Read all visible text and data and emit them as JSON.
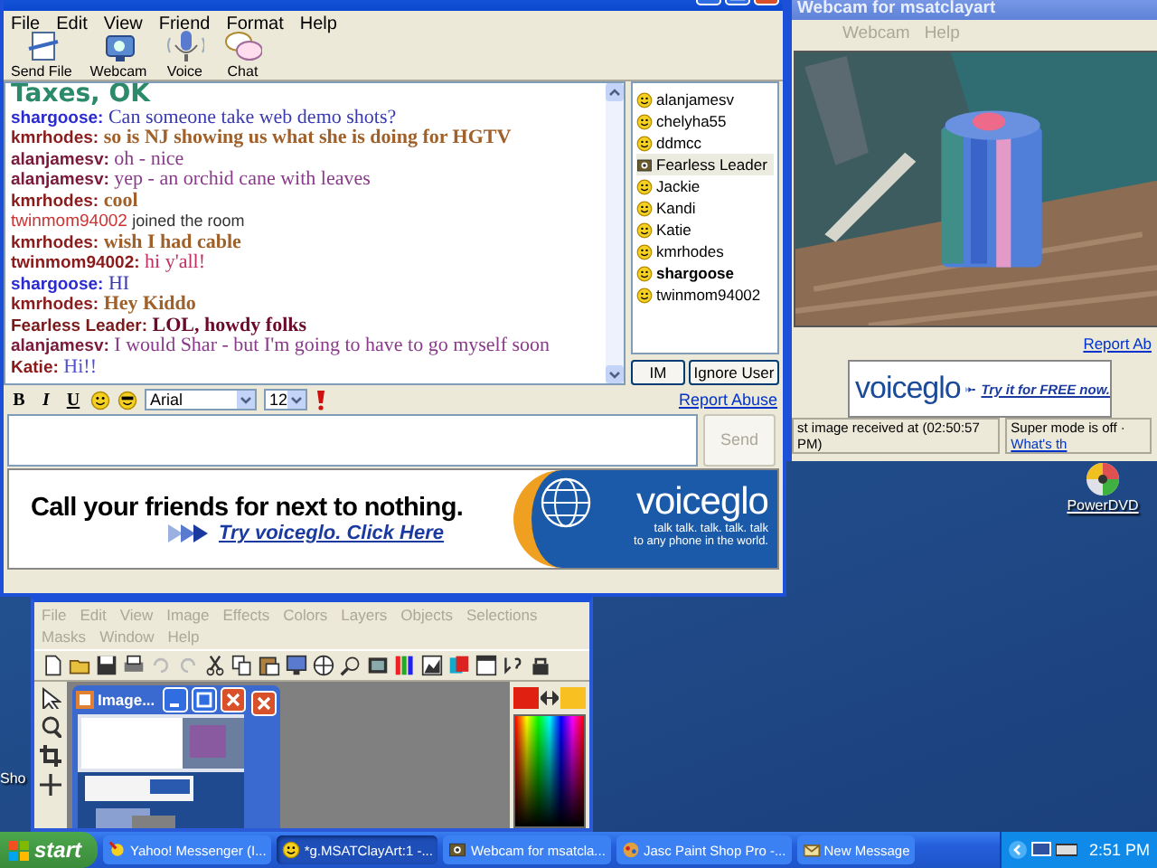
{
  "chat_window": {
    "menu": [
      "File",
      "Edit",
      "View",
      "Friend",
      "Format",
      "Help"
    ],
    "toolbar": [
      {
        "label": "Send File",
        "kind": "send_file"
      },
      {
        "label": "Webcam",
        "kind": "webcam"
      },
      {
        "label": "Voice",
        "kind": "voice"
      },
      {
        "label": "Chat",
        "kind": "chat"
      }
    ],
    "messages": [
      {
        "kind": "banner",
        "text": "Taxes, OK",
        "color": "#2a8a6a"
      },
      {
        "kind": "message",
        "user": {
          "name": "shargoose:",
          "color": "#2a2ad0"
        },
        "text": "Can someone take web demo shots?",
        "color": "#3a3ab0",
        "bold": false
      },
      {
        "kind": "message",
        "user": {
          "name": "kmrhodes:",
          "color": "#8b1a1a"
        },
        "text": "so is NJ showing us what she is doing for HGTV",
        "color": "#a0602a",
        "bold": true
      },
      {
        "kind": "message",
        "user": {
          "name": "alanjamesv:",
          "color": "#7a1a3a"
        },
        "text": "oh - nice",
        "color": "#8a3a8a",
        "bold": false
      },
      {
        "kind": "message",
        "user": {
          "name": "alanjamesv:",
          "color": "#7a1a3a"
        },
        "text": "yep - an orchid cane with leaves",
        "color": "#8a3a8a",
        "bold": false
      },
      {
        "kind": "message",
        "user": {
          "name": "kmrhodes:",
          "color": "#8b1a1a"
        },
        "text": "cool",
        "color": "#a0602a",
        "bold": true
      },
      {
        "kind": "join",
        "user": {
          "name": "twinmom94002",
          "color": "#cc3333"
        },
        "text": "joined the room",
        "color": "#333333",
        "bold": false
      },
      {
        "kind": "message",
        "user": {
          "name": "kmrhodes:",
          "color": "#8b1a1a"
        },
        "text": "wish I had cable",
        "color": "#a0602a",
        "bold": true
      },
      {
        "kind": "message",
        "user": {
          "name": "twinmom94002:",
          "color": "#8b1a1a"
        },
        "text": "hi y'all!",
        "color": "#c03060",
        "bold": false
      },
      {
        "kind": "message",
        "user": {
          "name": "shargoose:",
          "color": "#2a2ad0"
        },
        "text": "HI",
        "color": "#3a3ab0",
        "bold": false
      },
      {
        "kind": "message",
        "user": {
          "name": "kmrhodes:",
          "color": "#8b1a1a"
        },
        "text": "Hey Kiddo",
        "color": "#a0602a",
        "bold": true
      },
      {
        "kind": "message",
        "user": {
          "name": "Fearless Leader:",
          "color": "#7a1a1a"
        },
        "text": "LOL, howdy folks",
        "color": "#6a0a2a",
        "bold": true
      },
      {
        "kind": "message",
        "user": {
          "name": "alanjamesv:",
          "color": "#7a1a3a"
        },
        "text": "I would Shar - but I'm going to have to go myself soon",
        "color": "#8a3a8a",
        "bold": false
      },
      {
        "kind": "message",
        "user": {
          "name": "Katie:",
          "color": "#8b1a1a"
        },
        "text": "Hi!!",
        "color": "#5050d0",
        "bold": false
      }
    ],
    "users": [
      {
        "name": "alanjamesv",
        "kind": "smiley",
        "selected": false,
        "bold": false
      },
      {
        "name": "chelyha55",
        "kind": "smiley",
        "selected": false,
        "bold": false
      },
      {
        "name": "ddmcc",
        "kind": "smiley",
        "selected": false,
        "bold": false
      },
      {
        "name": "Fearless Leader",
        "kind": "webcam",
        "selected": true,
        "bold": false
      },
      {
        "name": "Jackie",
        "kind": "smiley",
        "selected": false,
        "bold": false
      },
      {
        "name": "Kandi",
        "kind": "smiley",
        "selected": false,
        "bold": false
      },
      {
        "name": "Katie",
        "kind": "smiley",
        "selected": false,
        "bold": false
      },
      {
        "name": "kmrhodes",
        "kind": "smiley",
        "selected": false,
        "bold": false
      },
      {
        "name": "shargoose",
        "kind": "smiley",
        "selected": false,
        "bold": true
      },
      {
        "name": "twinmom94002",
        "kind": "smiley",
        "selected": false,
        "bold": false
      }
    ],
    "user_buttons": [
      "IM",
      "Ignore User"
    ],
    "format_buttons": [
      {
        "label": "B",
        "kind": "bold"
      },
      {
        "label": "I",
        "kind": "italic"
      },
      {
        "label": "U",
        "kind": "underline"
      }
    ],
    "font": "Arial",
    "size": "12",
    "report_abuse": "Report Abuse",
    "send": {
      "label": "Send",
      "disabled": true
    },
    "ad": {
      "headline": "Call your friends for next to nothing.",
      "link": "Try voiceglo. Click Here",
      "brand": "voiceglo",
      "tagline": "talk  talk. talk. talk. talk",
      "tagline_2": "to any phone in the world."
    }
  },
  "webcam_window": {
    "title": "Webcam for msatclayart",
    "menu": [
      {
        "label": "Webcam",
        "disabled": true
      },
      {
        "label": "Help",
        "disabled": true
      }
    ],
    "report_abuse": "Report Ab",
    "ad": {
      "brand": "voiceglo",
      "link": "Try it for FREE now."
    },
    "status": "st image received at (02:50:57 PM)",
    "super_mode": "Super mode is off · ",
    "whats_this": "What's th"
  },
  "desktop_icons": [
    {
      "label": "PowerDVD",
      "kind": "disc"
    },
    {
      "label": "Sho",
      "kind": "partial"
    }
  ],
  "psp_window": {
    "menu": [
      "File",
      "Edit",
      "View",
      "Image",
      "Effects",
      "Colors",
      "Layers",
      "Objects",
      "Selections",
      "Masks",
      "Window",
      "Help"
    ],
    "image_title": "Image..."
  },
  "taskbar": {
    "start": "start",
    "tasks": [
      {
        "label": "Yahoo! Messenger (I...",
        "kind": "messenger",
        "selected": false
      },
      {
        "label": "*g.MSATClayArt:1 -...",
        "kind": "chat",
        "selected": true
      },
      {
        "label": "Webcam for msatcla...",
        "kind": "webcam",
        "selected": false
      },
      {
        "label": "Jasc Paint Shop Pro -...",
        "kind": "paint",
        "selected": false
      },
      {
        "label": "New Message",
        "kind": "mail",
        "selected": false
      }
    ],
    "clock": "2:51 PM"
  }
}
